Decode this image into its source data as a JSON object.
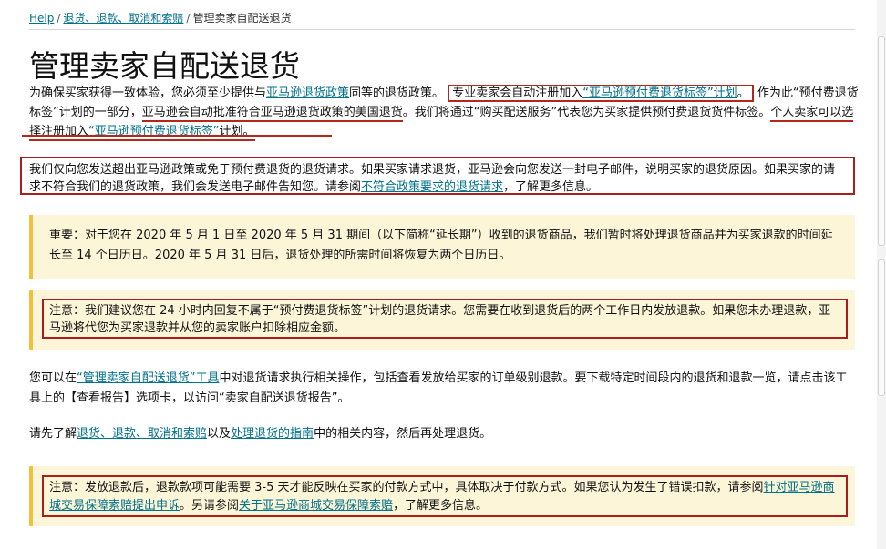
{
  "breadcrumb": {
    "help": "Help",
    "sep": "/",
    "returns": "退货、退款、取消和索赔",
    "current": "管理卖家自配送退货"
  },
  "page_title": "管理卖家自配送退货",
  "intro": {
    "t1": "为确保买家获得一致体验，您必须至少提供与",
    "link_policy": "亚马逊退货政策",
    "t2": "同等的退货政策。",
    "box_t1": "专业卖家会自动注册加入",
    "box_link": "“亚马逊预付费退货标签”计划",
    "box_t2": "。",
    "t3": "作为此“预付费退货标签”计划的一部分，",
    "ul1": "亚马逊会自动批准符合亚马逊退货政策的美国退货",
    "t4": "。我们将通过“购买配送服务”代表您为买家提供预付费退货货件标签。",
    "ul2": "个人卖家可以选择注册加入",
    "ul2_link": "“亚马逊预付费退货标签”",
    "ul2_t2": "计划。"
  },
  "request_box": {
    "t1": "我们仅向您发送超出亚马逊政策或免于预付费退货的退货请求。如果买家请求退货，亚马逊会向您发送一封电子邮件，说明买家的退货原因。如果买家的请求不符合我们的退货政策，我们会发送电子邮件告知您。请参阅",
    "link": "不符合政策要求的退货请求",
    "t2": "，了解更多信息。"
  },
  "alert1": {
    "text": "重要：对于您在 2020 年 5 月 1 日至 2020 年 5 月 31 期间（以下简称“延长期”）收到的退货商品，我们暂时将处理退货商品并为买家退款的时间延长至 14 个日历日。2020 年 5 月 31 日后，退货处理的所需时间将恢复为两个日历日。"
  },
  "alert2": {
    "text": "注意：我们建议您在 24 小时内回复不属于“预付费退货标签”计划的退货请求。您需要在收到退货后的两个工作日内发放退款。如果您未办理退款，亚马逊将代您为买家退款并从您的卖家账户扣除相应金额。"
  },
  "para1": {
    "t1": "您可以在",
    "link": "“管理卖家自配送退货”工具",
    "t2": "中对退货请求执行相关操作，包括查看发放给买家的订单级别退款。要下载特定时间段内的退货和退款一览，请点击该工具上的【查看报告】选项卡，以访问“卖家自配送退货报告”。"
  },
  "para2": {
    "t1": "请先了解",
    "link1": "退货、退款、取消和索赔",
    "t2": "以及",
    "link2": "处理退货的指南",
    "t3": "中的相关内容，然后再处理退货。"
  },
  "alert3": {
    "t1": "注意：发放退款后，退款款项可能需要 3-5 天才能反映在买家的付款方式中，具体取决于付款方式。如果您认为发生了错误扣款，请参阅",
    "link1": "针对亚马逊商城交易保障索赔提出申诉",
    "t2": "。另请参阅",
    "link2": "关于亚马逊商城交易保障索赔",
    "t3": "，了解更多信息。"
  },
  "colors": {
    "link": "#00718b",
    "annotation_red": "#b5261b",
    "alert_bg": "#fdf5d8",
    "alert_border": "#f1c13d"
  }
}
